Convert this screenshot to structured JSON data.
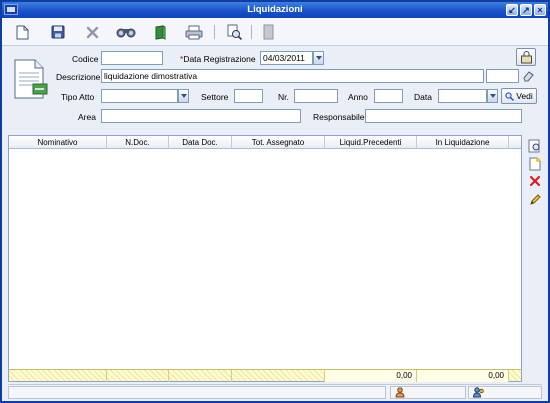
{
  "window": {
    "title": "Liquidazioni",
    "controls": [
      "minimize-icon",
      "maximize-icon",
      "close-icon"
    ]
  },
  "toolbar": {
    "buttons": [
      "new-document-icon",
      "save-icon",
      "delete-icon",
      "search-binoculars-icon",
      "book-icon",
      "print-icon",
      "print-preview-icon",
      "copy-icon"
    ]
  },
  "form": {
    "codice_label": "Codice",
    "codice_value": "",
    "data_registrazione_label": "Data Registrazione",
    "data_registrazione_required": "*",
    "data_registrazione_value": "04/03/2011",
    "descrizione_label": "Descrizione",
    "descrizione_value": "liquidazione dimostrativa",
    "descrizione_extra_value": "",
    "tipo_atto_label": "Tipo Atto",
    "tipo_atto_value": "",
    "settore_label": "Settore",
    "settore_value": "",
    "nr_label": "Nr.",
    "nr_value": "",
    "anno_label": "Anno",
    "anno_value": "",
    "data_label": "Data",
    "data_value": "",
    "vedi_label": "Vedi",
    "area_label": "Area",
    "area_value": "",
    "responsabile_label": "Responsabile",
    "responsabile_value": ""
  },
  "grid": {
    "columns": [
      "Nominativo",
      "N.Doc.",
      "Data Doc.",
      "Tot. Assegnato",
      "Liquid.Precedenti",
      "In Liquidazione"
    ],
    "rows": [],
    "totals": [
      "",
      "",
      "",
      "",
      "0,00",
      "0,00"
    ]
  },
  "side_actions": [
    "view-record-icon",
    "add-record-icon",
    "remove-record-icon",
    "edit-record-icon"
  ],
  "colors": {
    "titlebar": "#1750c8",
    "window_bg": "#e9eef7",
    "footer_bg": "#fffbd0",
    "required_mark": "#d40000"
  }
}
